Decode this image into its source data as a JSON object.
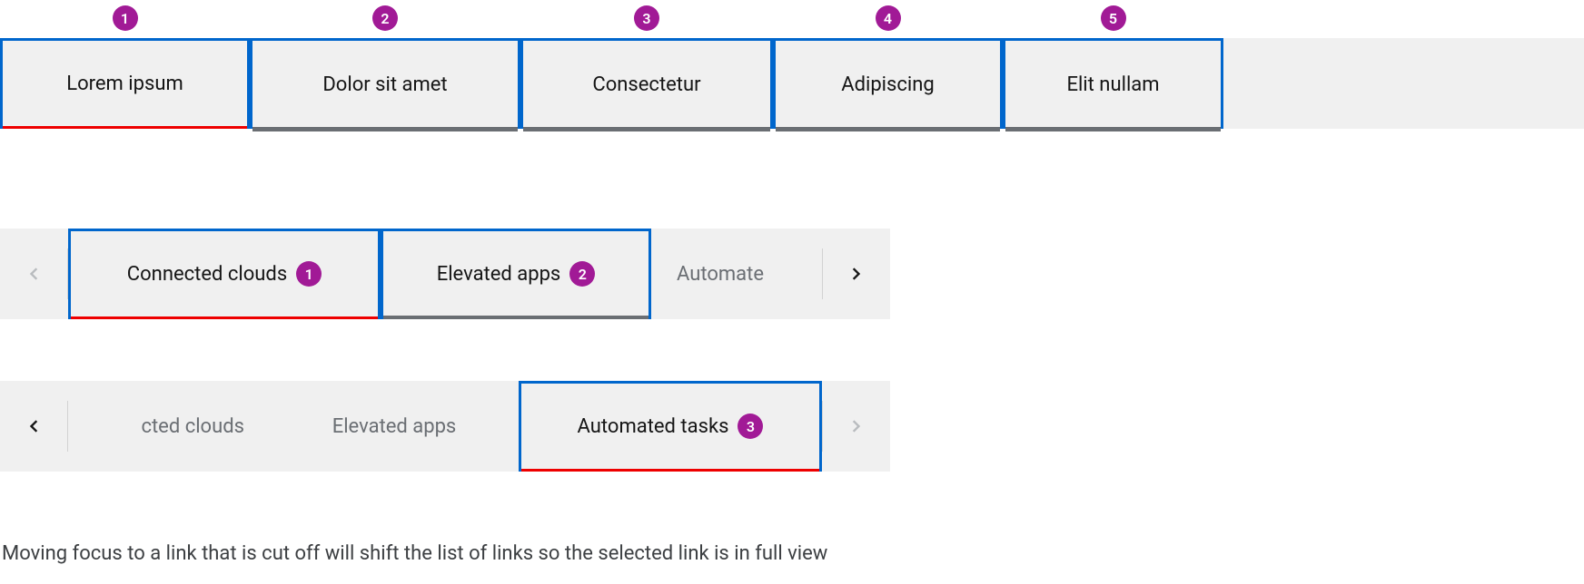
{
  "example1": {
    "tabs": [
      {
        "label": "Lorem ipsum",
        "badge": "1",
        "active": true
      },
      {
        "label": "Dolor sit amet",
        "badge": "2",
        "active": false
      },
      {
        "label": "Consectetur",
        "badge": "3",
        "active": false
      },
      {
        "label": "Adipiscing",
        "badge": "4",
        "active": false
      },
      {
        "label": "Elit nullam",
        "badge": "5",
        "active": false
      }
    ]
  },
  "example2a": {
    "tabs": [
      {
        "label": "Connected clouds",
        "badge": "1",
        "active": true,
        "focused": true
      },
      {
        "label": "Elevated apps",
        "badge": "2",
        "active": false,
        "focused": true
      },
      {
        "label_partial": "Automate",
        "cutoff": true
      }
    ],
    "scroll_left_disabled": true,
    "scroll_right_disabled": false
  },
  "example2b": {
    "tabs": [
      {
        "label_partial": "cted clouds",
        "cutoff": true
      },
      {
        "label": "Elevated apps",
        "cutoff": true
      },
      {
        "label": "Automated tasks",
        "badge": "3",
        "active": true,
        "focused": true
      }
    ],
    "scroll_left_disabled": false,
    "scroll_right_disabled": true
  },
  "caption": "Moving focus to a link that is cut off will shift the list of links so the selected link is in full view"
}
